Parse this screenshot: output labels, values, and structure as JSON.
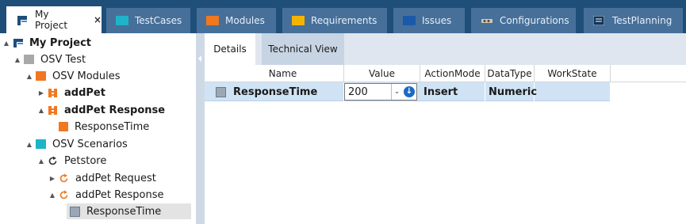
{
  "tabs": [
    {
      "label": "My Project",
      "icon": "project-icon",
      "active": true,
      "close": "×"
    },
    {
      "label": "TestCases",
      "icon": "testcases-icon"
    },
    {
      "label": "Modules",
      "icon": "modules-icon"
    },
    {
      "label": "Requirements",
      "icon": "requirements-icon"
    },
    {
      "label": "Issues",
      "icon": "issues-icon"
    },
    {
      "label": "Configurations",
      "icon": "configurations-icon"
    },
    {
      "label": "TestPlanning",
      "icon": "testplanning-icon"
    }
  ],
  "tree": [
    {
      "label": "My Project",
      "icon": "project-icon",
      "expander": "▲"
    },
    {
      "label": "OSV Test",
      "icon": "folder-gray-icon",
      "expander": "▲"
    },
    {
      "label": "OSV Modules",
      "icon": "folder-orange-icon",
      "expander": "▲"
    },
    {
      "label": "addPet",
      "icon": "module-orange-icon",
      "expander": "▶"
    },
    {
      "label": "addPet Response",
      "icon": "module-orange-icon",
      "expander": "▲"
    },
    {
      "label": "ResponseTime",
      "icon": "orange-square-icon",
      "expander": ""
    },
    {
      "label": "OSV Scenarios",
      "icon": "folder-teal-icon",
      "expander": "▲"
    },
    {
      "label": "Petstore",
      "icon": "refresh-icon",
      "expander": "▲"
    },
    {
      "label": "addPet Request",
      "icon": "refresh-orange-icon",
      "expander": "▶"
    },
    {
      "label": "addPet Response",
      "icon": "refresh-orange-icon",
      "expander": "▲"
    },
    {
      "label": "ResponseTime",
      "icon": "gray-square-icon",
      "expander": "",
      "selected": true
    }
  ],
  "subtabs": {
    "details": "Details",
    "technical": "Technical View"
  },
  "grid": {
    "headers": [
      "Name",
      "Value",
      "ActionMode",
      "DataType",
      "WorkState"
    ],
    "row": {
      "name": "ResponseTime",
      "value": "200",
      "action_mode": "Insert",
      "data_type": "Numeric",
      "work_state": ""
    }
  },
  "colors": {
    "titlebar": "#1f4e79",
    "tab_inactive": "#46709a",
    "row_selected": "#cfe3f5",
    "accent_orange": "#f07820",
    "accent_teal": "#1eb4c8"
  }
}
